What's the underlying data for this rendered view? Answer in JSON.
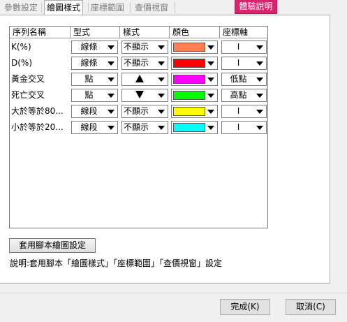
{
  "tabs": [
    {
      "label": "參數設定",
      "active": false
    },
    {
      "label": "繪圖樣式",
      "active": true
    },
    {
      "label": "座標範圍",
      "active": false
    },
    {
      "label": "查價視窗",
      "active": false
    }
  ],
  "help_button": {
    "label": "體驗說明",
    "color": "#d6246e"
  },
  "grid": {
    "columns": [
      "序列名稱",
      "型式",
      "樣式",
      "顏色",
      "座標軸"
    ],
    "rows": [
      {
        "name": "K(%)",
        "type": "線條",
        "style": "不顯示",
        "color": "#ff7f50",
        "axis": "I"
      },
      {
        "name": "D(%)",
        "type": "線條",
        "style": "不顯示",
        "color": "#ff0000",
        "axis": "I"
      },
      {
        "name": "黃金交叉",
        "type": "點",
        "style_icon": "triangle-up-icon",
        "color": "#ff00ff",
        "axis": "低點"
      },
      {
        "name": "死亡交叉",
        "type": "點",
        "style_icon": "triangle-down-icon",
        "color": "#00ff00",
        "axis": "高點"
      },
      {
        "name": "大於等於80...",
        "type": "線段",
        "style": "不顯示",
        "color": "#ffff00",
        "axis": "I"
      },
      {
        "name": "小於等於20...",
        "type": "線段",
        "style": "不顯示",
        "color": "#00ffff",
        "axis": "I"
      }
    ]
  },
  "apply_button": {
    "label": "套用腳本繪圖設定"
  },
  "description": "說明:套用腳本「繪圖樣式」「座標範圍」「查價視窗」設定",
  "footer": {
    "ok_label": "完成(K)",
    "cancel_label": "取消(C)"
  }
}
